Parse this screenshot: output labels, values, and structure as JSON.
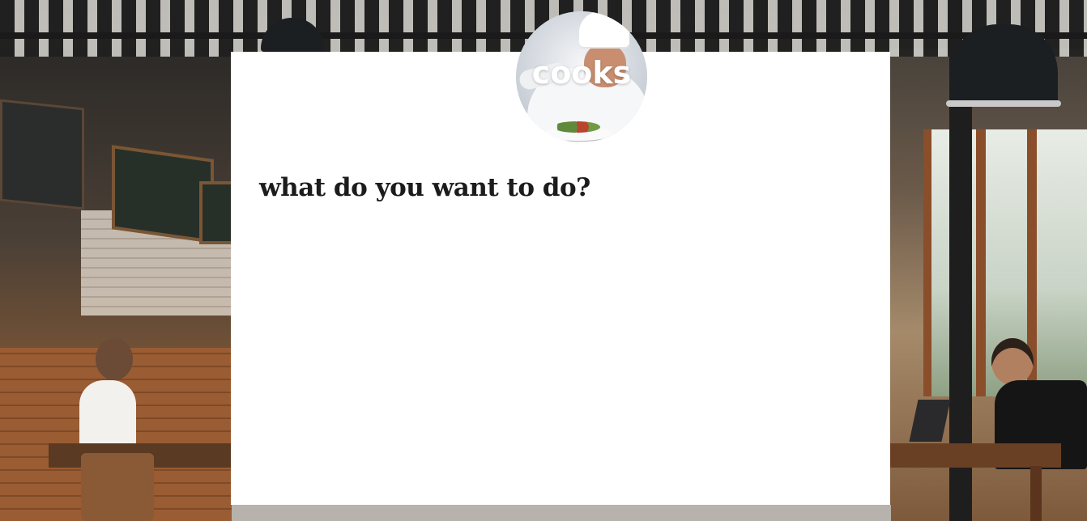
{
  "logo": {
    "text": "cooks"
  },
  "main": {
    "heading": "what do you want to do?"
  },
  "colors": {
    "panel_background": "#ffffff",
    "heading_text": "#1c1c1c",
    "logo_text": "#ffffff"
  }
}
